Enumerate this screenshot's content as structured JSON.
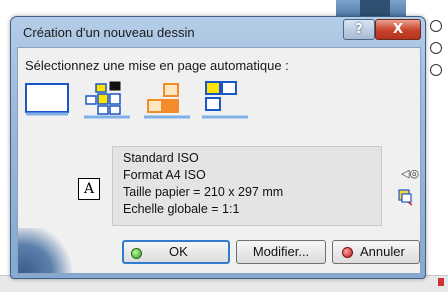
{
  "dialog": {
    "title": "Création d'un nouveau dessin",
    "help_label": "?",
    "close_label": "X",
    "instruction": "Sélectionnez une mise en page automatique :",
    "layouts": [
      {
        "name": "empty-sheet",
        "selected": true
      },
      {
        "name": "all-views"
      },
      {
        "name": "front-bottom-right"
      },
      {
        "name": "front-top-left"
      }
    ],
    "info": [
      "Standard ISO",
      "Format A4 ISO",
      "Taille papier = 210 x 297 mm",
      "Echelle globale = 1:1"
    ],
    "standard_icon": "A",
    "buttons": {
      "ok": "OK",
      "modify": "Modifier...",
      "cancel": "Annuler"
    }
  },
  "colors": {
    "accent": "#2f7bd0",
    "frame": "#9ab8da",
    "orange": "#f28c28",
    "blue": "#1a56c6",
    "yellow": "#ffe400"
  }
}
